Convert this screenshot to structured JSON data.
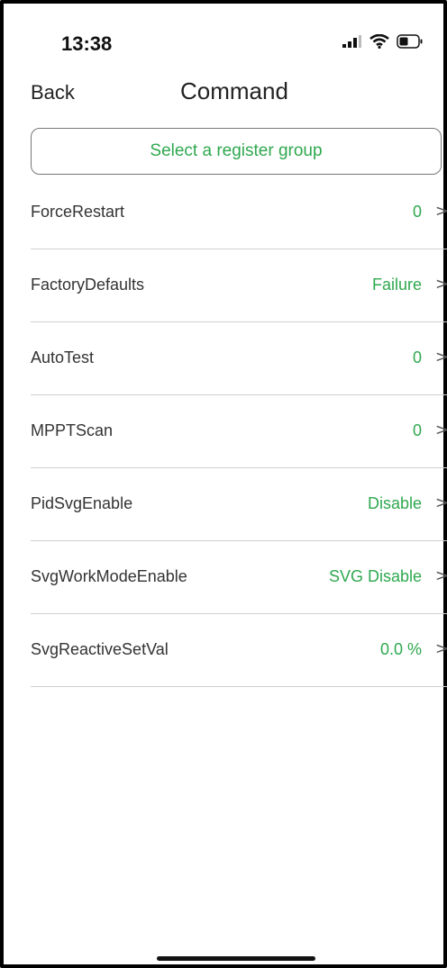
{
  "status_bar": {
    "time": "13:38"
  },
  "header": {
    "back_label": "Back",
    "title": "Command"
  },
  "register_group": {
    "placeholder": "Select a register group"
  },
  "commands": [
    {
      "label": "ForceRestart",
      "value": "0"
    },
    {
      "label": "FactoryDefaults",
      "value": "Failure"
    },
    {
      "label": "AutoTest",
      "value": "0"
    },
    {
      "label": "MPPTScan",
      "value": "0"
    },
    {
      "label": "PidSvgEnable",
      "value": "Disable"
    },
    {
      "label": "SvgWorkModeEnable",
      "value": "SVG Disable"
    },
    {
      "label": "SvgReactiveSetVal",
      "value": "0.0 %"
    }
  ],
  "chevron": ">",
  "colors": {
    "accent": "#2fa84f",
    "text": "#333333",
    "divider": "#d0d0d0"
  },
  "icons": [
    "signal-icon",
    "wifi-icon",
    "battery-icon",
    "chevron-right-icon"
  ]
}
